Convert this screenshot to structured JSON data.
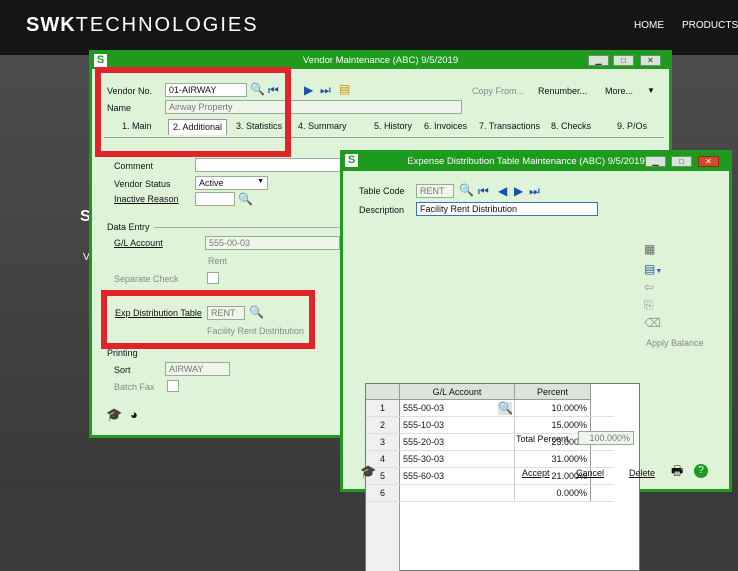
{
  "website": {
    "logo_bold": "SWK",
    "logo_rest": "TECHNOLOGIES",
    "nav": [
      "HOME",
      "PRODUCTS"
    ]
  },
  "vendor_win": {
    "title": "Vendor Maintenance (ABC) 9/5/2019",
    "vendor_no_label": "Vendor No.",
    "vendor_no": "01-AIRWAY",
    "name_label": "Name",
    "name": "Airway Property",
    "toolbar": {
      "copy_from": "Copy From...",
      "renumber": "Renumber...",
      "more": "More..."
    },
    "tabs": [
      "1. Main",
      "2. Additional",
      "3. Statistics",
      "4. Summary",
      "5. History",
      "6. Invoices",
      "7. Transactions",
      "8. Checks",
      "9. P/Os"
    ],
    "comment_label": "Comment",
    "vendor_status_label": "Vendor Status",
    "vendor_status": "Active",
    "inactive_reason_label": "Inactive Reason",
    "data_entry_label": "Data Entry",
    "gl_account_label": "G/L Account",
    "gl_account": "555-00-03",
    "gl_desc": "Rent",
    "separate_check_label": "Separate Check",
    "exp_dist_label": "Exp Distribution Table",
    "exp_dist": "RENT",
    "exp_dist_desc": "Facility Rent Distribution",
    "printing_label": "Printing",
    "sort_label": "Sort",
    "sort": "AIRWAY",
    "batch_fax_label": "Batch Fax"
  },
  "exp_win": {
    "title": "Expense Distribution Table Maintenance (ABC) 9/5/2019",
    "table_code_label": "Table Code",
    "table_code": "RENT",
    "description_label": "Description",
    "description": "Facility Rent Distribution",
    "col_gl": "G/L Account",
    "col_pct": "Percent",
    "rows": [
      {
        "n": "1",
        "gl": "555-00-03",
        "pct": "10.000%"
      },
      {
        "n": "2",
        "gl": "555-10-03",
        "pct": "15.000%"
      },
      {
        "n": "3",
        "gl": "555-20-03",
        "pct": "23.000%"
      },
      {
        "n": "4",
        "gl": "555-30-03",
        "pct": "31.000%"
      },
      {
        "n": "5",
        "gl": "555-60-03",
        "pct": "21.000%"
      },
      {
        "n": "6",
        "gl": "",
        "pct": "0.000%"
      }
    ],
    "apply_balance": "Apply Balance",
    "total_label": "Total Percent",
    "total": "100.000%",
    "accept": "Accept",
    "cancel": "Cancel",
    "delete": "Delete"
  },
  "colors": {
    "accent": "#1e9a1e",
    "highlight": "#e2242a",
    "window_bg": "#dff3d8"
  }
}
